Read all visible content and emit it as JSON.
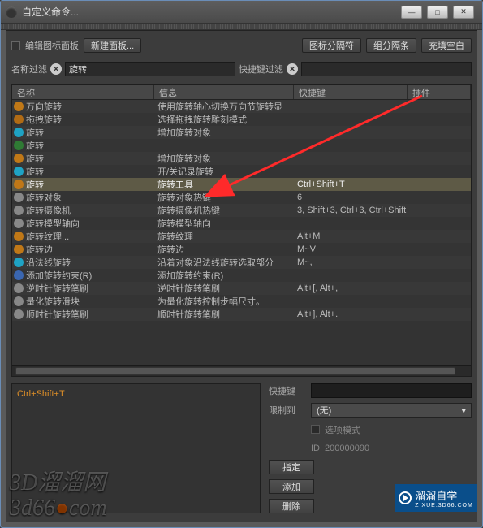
{
  "window": {
    "title": "自定义命令..."
  },
  "toolbar": {
    "edit_icon_panel": "编辑图标面板",
    "new_panel": "新建面板...",
    "right": {
      "icon_sep": "图标分隔符",
      "group_sep": "组分隔条",
      "fill_blank": "充填空白"
    }
  },
  "filters": {
    "name_label": "名称过滤",
    "name_value": "旋转",
    "hotkey_label": "快捷键过滤",
    "hotkey_value": ""
  },
  "columns": {
    "name": "名称",
    "info": "信息",
    "hotkey": "快捷键",
    "plugin": "插件"
  },
  "col_widths": {
    "name": 175,
    "info": 172,
    "hotkey": 140,
    "plugin": 60
  },
  "rows": [
    {
      "icon": "#c07817",
      "name": "万向旋转",
      "info": "使用旋转轴心切换万向节旋转显",
      "hotkey": "",
      "plugin": ""
    },
    {
      "icon": "#b16b14",
      "name": "拖拽旋转",
      "info": "选择拖拽旋转雕刻模式",
      "hotkey": "",
      "plugin": ""
    },
    {
      "icon": "#1fa3c4",
      "name": "旋转",
      "info": "增加旋转对象",
      "hotkey": "",
      "plugin": ""
    },
    {
      "icon": "#2f7a34",
      "name": "旋转",
      "info": "",
      "hotkey": "",
      "plugin": ""
    },
    {
      "icon": "#c07817",
      "name": "旋转",
      "info": "增加旋转对象",
      "hotkey": "",
      "plugin": ""
    },
    {
      "icon": "#1fa3c4",
      "name": "旋转",
      "info": "开/关记录旋转",
      "hotkey": "",
      "plugin": ""
    },
    {
      "icon": "#c07817",
      "name": "旋转",
      "info": "旋转工具",
      "hotkey": "Ctrl+Shift+T",
      "plugin": "",
      "sel": true
    },
    {
      "icon": "#888",
      "name": "旋转对象",
      "info": "旋转对象热键",
      "hotkey": "6",
      "plugin": ""
    },
    {
      "icon": "#888",
      "name": "旋转摄像机",
      "info": "旋转摄像机热键",
      "hotkey": "3, Shift+3, Ctrl+3, Ctrl+Shift+",
      "plugin": ""
    },
    {
      "icon": "#888",
      "name": "旋转模型轴向",
      "info": "旋转模型轴向",
      "hotkey": "",
      "plugin": ""
    },
    {
      "icon": "#c07817",
      "name": "旋转纹理...",
      "info": "旋转纹理",
      "hotkey": "Alt+M",
      "plugin": ""
    },
    {
      "icon": "#c07817",
      "name": "旋转边",
      "info": "旋转边",
      "hotkey": "M~V",
      "plugin": ""
    },
    {
      "icon": "#1fa3c4",
      "name": "沿法线旋转",
      "info": "沿着对象沿法线旋转选取部分",
      "hotkey": "M~,",
      "plugin": ""
    },
    {
      "icon": "#3a66b0",
      "name": "添加旋转约束(R)",
      "info": "添加旋转约束(R)",
      "hotkey": "",
      "plugin": ""
    },
    {
      "icon": "#888",
      "name": "逆时针旋转笔刷",
      "info": "逆时针旋转笔刷",
      "hotkey": "Alt+[, Alt+,",
      "plugin": ""
    },
    {
      "icon": "#888",
      "name": "量化旋转滑块",
      "info": "为量化旋转控制步幅尺寸。",
      "hotkey": "",
      "plugin": ""
    },
    {
      "icon": "#888",
      "name": "顺时针旋转笔刷",
      "info": "顺时针旋转笔刷",
      "hotkey": "Alt+], Alt+.",
      "plugin": ""
    }
  ],
  "details": {
    "current_hotkey": "Ctrl+Shift+T",
    "hotkey_label": "快捷键",
    "limit_label": "限制到",
    "limit_value": "(无)",
    "option_mode": "选项模式",
    "id_label": "ID",
    "id_value": "200000090",
    "assign": "指定",
    "add": "添加",
    "delete": "删除"
  },
  "watermark": {
    "line1": "3D溜溜网",
    "line2_a": "3d66",
    "line2_b": "com"
  },
  "brand": {
    "text": "溜溜自学",
    "sub": "ZIXUE.3D66.COM"
  }
}
